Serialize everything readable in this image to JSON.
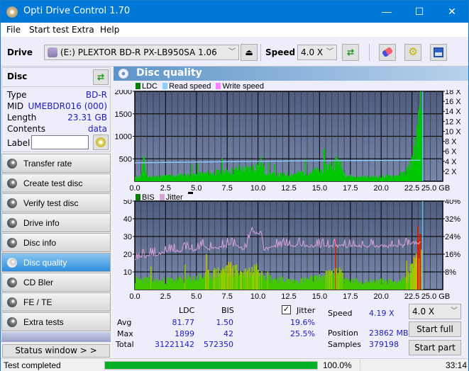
{
  "window": {
    "title": "Opti Drive Control 1.70",
    "minimize": "—",
    "maximize": "☐",
    "close": "✕"
  },
  "menu": [
    "File",
    "Start test",
    "Extra",
    "Help"
  ],
  "toolbar": {
    "drive_label": "Drive",
    "drive_value": "(E:)  PLEXTOR BD-R  PX-LB950SA 1.06",
    "speed_label": "Speed",
    "speed_value": "4.0 X"
  },
  "disc": {
    "header": "Disc",
    "rows": [
      {
        "label": "Type",
        "value": "BD-R"
      },
      {
        "label": "MID",
        "value": "UMEBDR016 (000)"
      },
      {
        "label": "Length",
        "value": "23.31 GB"
      },
      {
        "label": "Contents",
        "value": "data"
      }
    ],
    "label_field_label": "Label",
    "label_field_value": ""
  },
  "nav": [
    {
      "label": "Transfer rate",
      "active": false
    },
    {
      "label": "Create test disc",
      "active": false
    },
    {
      "label": "Verify test disc",
      "active": false
    },
    {
      "label": "Drive info",
      "active": false
    },
    {
      "label": "Disc info",
      "active": false
    },
    {
      "label": "Disc quality",
      "active": true
    },
    {
      "label": "CD Bler",
      "active": false
    },
    {
      "label": "FE / TE",
      "active": false
    },
    {
      "label": "Extra tests",
      "active": false
    }
  ],
  "status_window_button": "Status window > >",
  "main": {
    "title": "Disc quality"
  },
  "colors": {
    "ldc": "#00c000",
    "read_speed": "#8ccfff",
    "write_speed": "#ff80ff",
    "bis": "#00c000",
    "jitter": "#d8a0d8",
    "plot_bg_top": "#4e5c80",
    "plot_bg_bottom": "#7888ac",
    "progress": "#06b025",
    "value_text": "#1a1acc"
  },
  "chart_data": [
    {
      "type": "area",
      "title": "LDC / Read speed",
      "legend": [
        "LDC",
        "Read speed",
        "Write speed"
      ],
      "legend_position": "top-left",
      "xlabel": "GB",
      "xlim": [
        0,
        25
      ],
      "x_ticks": [
        "0.0",
        "2.5",
        "5.0",
        "7.5",
        "10.0",
        "12.5",
        "15.0",
        "17.5",
        "20.0",
        "22.5",
        "25.0 GB"
      ],
      "ylim_left": [
        0,
        2000
      ],
      "y_ticks_left": [
        "500",
        "1000",
        "1500",
        "2000"
      ],
      "ylim_right": [
        0,
        18
      ],
      "y_ticks_right": [
        "2 X",
        "4 X",
        "6 X",
        "8 X",
        "10 X",
        "12 X",
        "14 X",
        "16 X",
        "18 X"
      ],
      "grid": true,
      "series": [
        {
          "name": "LDC",
          "x": [
            0,
            0.5,
            0.7,
            1,
            2,
            3,
            4,
            5,
            6,
            7,
            8,
            8.5,
            9,
            9.5,
            10,
            10.3,
            10.5,
            11,
            12,
            13,
            14,
            15,
            16,
            16.5,
            17,
            17.5,
            18,
            19,
            20,
            21,
            22,
            22.5,
            23,
            23.2,
            23.31
          ],
          "values": [
            100,
            110,
            480,
            100,
            110,
            130,
            150,
            170,
            190,
            220,
            250,
            300,
            280,
            320,
            400,
            450,
            250,
            170,
            150,
            180,
            220,
            250,
            400,
            500,
            200,
            120,
            100,
            100,
            110,
            120,
            200,
            500,
            1200,
            1700,
            1899
          ]
        },
        {
          "name": "Read speed",
          "x": [
            0,
            1.8,
            3.6,
            5.4,
            7.2,
            9,
            10.8,
            12.6,
            14.4,
            16.2,
            18,
            19.8,
            21.6,
            23.3
          ],
          "values": [
            3.7,
            3.75,
            3.8,
            3.85,
            3.9,
            3.95,
            4.0,
            4.05,
            4.1,
            4.12,
            4.15,
            4.17,
            4.19,
            4.19
          ]
        },
        {
          "name": "Write speed",
          "x": [],
          "values": []
        }
      ]
    },
    {
      "type": "area",
      "title": "BIS / Jitter",
      "legend": [
        "BIS",
        "Jitter"
      ],
      "legend_position": "top-left",
      "xlabel": "GB",
      "xlim": [
        0,
        25
      ],
      "x_ticks": [
        "0.0",
        "2.5",
        "5.0",
        "7.5",
        "10.0",
        "12.5",
        "15.0",
        "17.5",
        "20.0",
        "22.5",
        "25.0 GB"
      ],
      "ylim_left": [
        0,
        50
      ],
      "y_ticks_left": [
        "10",
        "20",
        "30",
        "40",
        "50"
      ],
      "ylim_right": [
        0,
        40
      ],
      "y_ticks_right": [
        "8%",
        "16%",
        "24%",
        "32%",
        "40%"
      ],
      "grid": true,
      "series": [
        {
          "name": "BIS",
          "x": [
            0,
            1,
            2,
            3,
            4,
            5,
            6,
            7,
            7.5,
            8,
            9,
            10,
            11,
            12,
            13,
            14,
            15,
            16,
            16.5,
            17,
            18,
            19,
            20,
            21,
            22,
            22.5,
            23,
            23.31
          ],
          "values": [
            6,
            6,
            5,
            6,
            6,
            7,
            9,
            11,
            13,
            12,
            10,
            14,
            7,
            6,
            5,
            6,
            7,
            10,
            14,
            6,
            5,
            5,
            5,
            5,
            6,
            14,
            30,
            42
          ]
        },
        {
          "name": "Jitter (%)",
          "x": [
            0,
            1,
            2,
            3,
            4,
            5,
            5.6,
            6,
            7,
            8,
            9,
            9.4,
            10.3,
            10.5,
            11,
            12,
            13,
            14,
            15,
            16,
            17,
            18,
            19,
            20,
            21,
            22,
            22.6,
            23.2
          ],
          "values": [
            13.5,
            15,
            16,
            17,
            17.5,
            18,
            20,
            18,
            19,
            20,
            18,
            25.5,
            25.5,
            18,
            19,
            19.5,
            19.5,
            19.5,
            19.5,
            19.5,
            19.5,
            19.5,
            19.5,
            19.5,
            19.5,
            19.5,
            21,
            21
          ]
        }
      ]
    }
  ],
  "stats": {
    "col_ldc": "LDC",
    "col_bis": "BIS",
    "jitter_label": "Jitter",
    "jitter_checked": true,
    "rows": [
      {
        "label": "Avg",
        "ldc": "81.77",
        "bis": "1.50",
        "jitter": "19.6%"
      },
      {
        "label": "Max",
        "ldc": "1899",
        "bis": "42",
        "jitter": "25.5%"
      },
      {
        "label": "Total",
        "ldc": "31221142",
        "bis": "572350",
        "jitter": ""
      }
    ],
    "speed_label": "Speed",
    "speed_value": "4.19 X",
    "position_label": "Position",
    "position_value": "23862 MB",
    "samples_label": "Samples",
    "samples_value": "379198",
    "speed_select": "4.0 X",
    "start_full": "Start full",
    "start_part": "Start part"
  },
  "statusbar": {
    "text": "Test completed",
    "progress": 100.0,
    "progress_text": "100.0%",
    "time": "33:14"
  }
}
